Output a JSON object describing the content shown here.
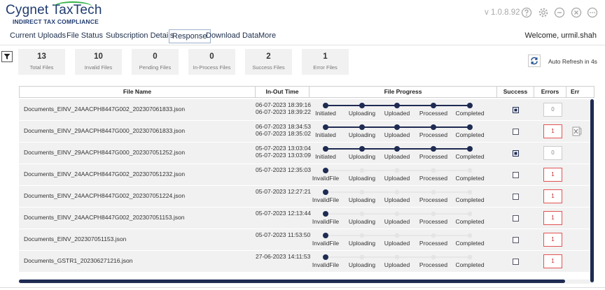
{
  "header": {
    "logo_title": "Cygnet TaxTech",
    "logo_subtitle": "INDIRECT TAX COMPLIANCE",
    "version": "v 1.0.8.92",
    "icons": [
      "help-icon",
      "settings-icon",
      "minimize-icon",
      "close-icon",
      "more-icon"
    ]
  },
  "nav": {
    "items": [
      "Current Uploads",
      "File Status",
      "Subscription Details",
      "Response",
      "Download Data",
      "More"
    ],
    "active": "Response",
    "welcome": "Welcome, urmil.shah"
  },
  "summary": [
    {
      "value": "13",
      "label": "Total Files"
    },
    {
      "value": "10",
      "label": "Invalid Files"
    },
    {
      "value": "0",
      "label": "Pending Files"
    },
    {
      "value": "0",
      "label": "In-Process Files"
    },
    {
      "value": "2",
      "label": "Success Files"
    },
    {
      "value": "1",
      "label": "Error Files"
    }
  ],
  "refresh": {
    "label": "Auto Refresh in 4s"
  },
  "table": {
    "columns": [
      "File Name",
      "In-Out Time",
      "File Progress",
      "Success",
      "Errors",
      "Err"
    ],
    "stages": [
      "Initiated",
      "Uploading",
      "Uploaded",
      "Processed",
      "Completed"
    ],
    "invalid_stage": "InvalidFile",
    "rows": [
      {
        "file": "Documents_EINV_24AACPH8447G002_202307061833.json",
        "times": [
          "06-07-2023 18:39:16",
          "06-07-2023 18:39:22"
        ],
        "status": "complete",
        "success": true,
        "errors": "0",
        "xls": false
      },
      {
        "file": "Documents_EINV_29AACPH8447G000_202307061833.json",
        "times": [
          "06-07-2023 18:34:53",
          "06-07-2023 18:35:02"
        ],
        "status": "complete",
        "success": false,
        "errors": "1",
        "xls": true
      },
      {
        "file": "Documents_EINV_29AACPH8447G000_202307051252.json",
        "times": [
          "05-07-2023 13:03:04",
          "05-07-2023 13:03:09"
        ],
        "status": "complete",
        "success": true,
        "errors": "0",
        "xls": false
      },
      {
        "file": "Documents_EINV_24AACPH8447G002_202307051232.json",
        "times": [
          "05-07-2023 12:35:03"
        ],
        "status": "invalid",
        "success": false,
        "errors": "1",
        "xls": false
      },
      {
        "file": "Documents_EINV_24AACPH8447G002_202307051224.json",
        "times": [
          "05-07-2023 12:27:21"
        ],
        "status": "invalid",
        "success": false,
        "errors": "1",
        "xls": false
      },
      {
        "file": "Documents_EINV_24AACPH8447G002_202307051153.json",
        "times": [
          "05-07-2023 12:13:44"
        ],
        "status": "invalid",
        "success": false,
        "errors": "1",
        "xls": false
      },
      {
        "file": "Documents_EINV_202307051153.json",
        "times": [
          "05-07-2023 11:53:50"
        ],
        "status": "invalid",
        "success": false,
        "errors": "1",
        "xls": false
      },
      {
        "file": "Documents_GSTR1_202306271216.json",
        "times": [
          "27-06-2023 14:11:53"
        ],
        "status": "invalid",
        "success": false,
        "errors": "1",
        "xls": false
      }
    ]
  },
  "colors": {
    "navy": "#1e2b52",
    "error_red": "#e35252",
    "pending_dot": "#e4e4e4",
    "row_bg": "#f1f1f1"
  }
}
